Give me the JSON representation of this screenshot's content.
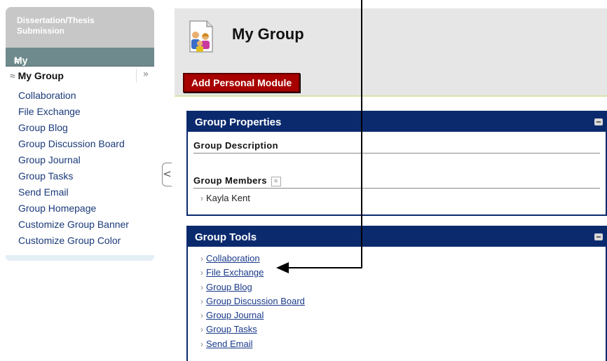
{
  "sidebar": {
    "course_title": "Dissertation/Thesis Submission",
    "my_groups_label": "My Groups",
    "my_group_label": "My Group",
    "expand_glyph": "»",
    "links": [
      "Collaboration",
      "File Exchange",
      "Group Blog",
      "Group Discussion Board",
      "Group Journal",
      "Group Tasks",
      "Send Email",
      "Group Homepage",
      "Customize Group Banner",
      "Customize Group Color"
    ]
  },
  "header": {
    "title": "My Group",
    "add_module_button": "Add Personal Module",
    "icon": "group-people-icon"
  },
  "group_properties": {
    "title": "Group Properties",
    "description_label": "Group Description",
    "members_label": "Group Members",
    "members": [
      "Kayla Kent"
    ]
  },
  "group_tools": {
    "title": "Group Tools",
    "tools": [
      "Collaboration",
      "File Exchange",
      "Group Blog",
      "Group Discussion Board",
      "Group Journal",
      "Group Tasks",
      "Send Email"
    ]
  },
  "colors": {
    "module_header": "#0b2a6e",
    "add_button": "#a80000",
    "sidebar_group_bar": "#6e8a8d",
    "link": "#1a3a8a"
  }
}
